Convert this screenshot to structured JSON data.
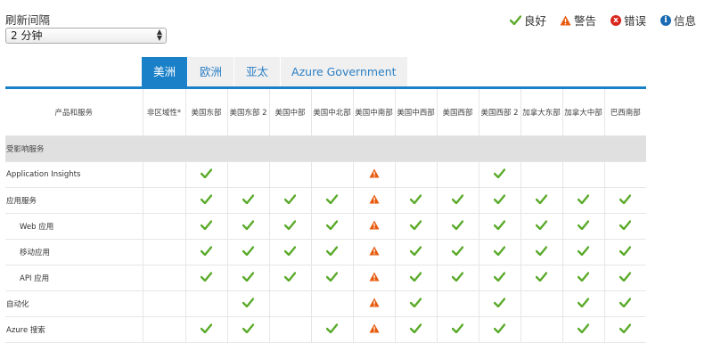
{
  "refresh": {
    "label": "刷新间隔",
    "selected": "2 分钟"
  },
  "legend": {
    "good": "良好",
    "warning": "警告",
    "error": "错误",
    "info": "信息"
  },
  "tabs": [
    {
      "label": "美洲",
      "active": true
    },
    {
      "label": "欧洲",
      "active": false
    },
    {
      "label": "亚太",
      "active": false
    },
    {
      "label": "Azure Government",
      "active": false
    }
  ],
  "table": {
    "headers": [
      "产品和服务",
      "非区域性*",
      "美国东部",
      "美国东部 2",
      "美国中部",
      "美国中北部",
      "美国中南部",
      "美国中西部",
      "美国西部",
      "美国西部 2",
      "加拿大东部",
      "加拿大中部",
      "巴西南部"
    ],
    "section_label": "受影响服务",
    "rows": [
      {
        "name": "Application Insights",
        "indent": false,
        "cells": [
          "",
          "good",
          "",
          "",
          "",
          "warning",
          "",
          "",
          "good",
          "",
          "",
          ""
        ]
      },
      {
        "name": "应用服务",
        "indent": false,
        "cells": [
          "",
          "good",
          "good",
          "good",
          "good",
          "warning",
          "good",
          "good",
          "good",
          "good",
          "good",
          "good"
        ]
      },
      {
        "name": "Web 应用",
        "indent": true,
        "cells": [
          "",
          "good",
          "good",
          "good",
          "good",
          "warning",
          "good",
          "good",
          "good",
          "good",
          "good",
          "good"
        ]
      },
      {
        "name": "移动应用",
        "indent": true,
        "cells": [
          "",
          "good",
          "good",
          "good",
          "good",
          "warning",
          "good",
          "good",
          "good",
          "good",
          "good",
          "good"
        ]
      },
      {
        "name": "API 应用",
        "indent": true,
        "cells": [
          "",
          "good",
          "good",
          "good",
          "good",
          "warning",
          "good",
          "good",
          "good",
          "good",
          "good",
          "good"
        ]
      },
      {
        "name": "自动化",
        "indent": false,
        "cells": [
          "",
          "",
          "good",
          "",
          "",
          "warning",
          "good",
          "",
          "good",
          "",
          "good",
          "good"
        ]
      },
      {
        "name": "Azure 搜索",
        "indent": false,
        "cells": [
          "",
          "good",
          "good",
          "",
          "good",
          "warning",
          "good",
          "good",
          "good",
          "",
          "good",
          "good"
        ]
      }
    ]
  },
  "colors": {
    "good": "#5aaa2a",
    "warning": "#e8590c",
    "error": "#d9261c",
    "info": "#1a6bb3",
    "accent": "#1a80c8"
  }
}
